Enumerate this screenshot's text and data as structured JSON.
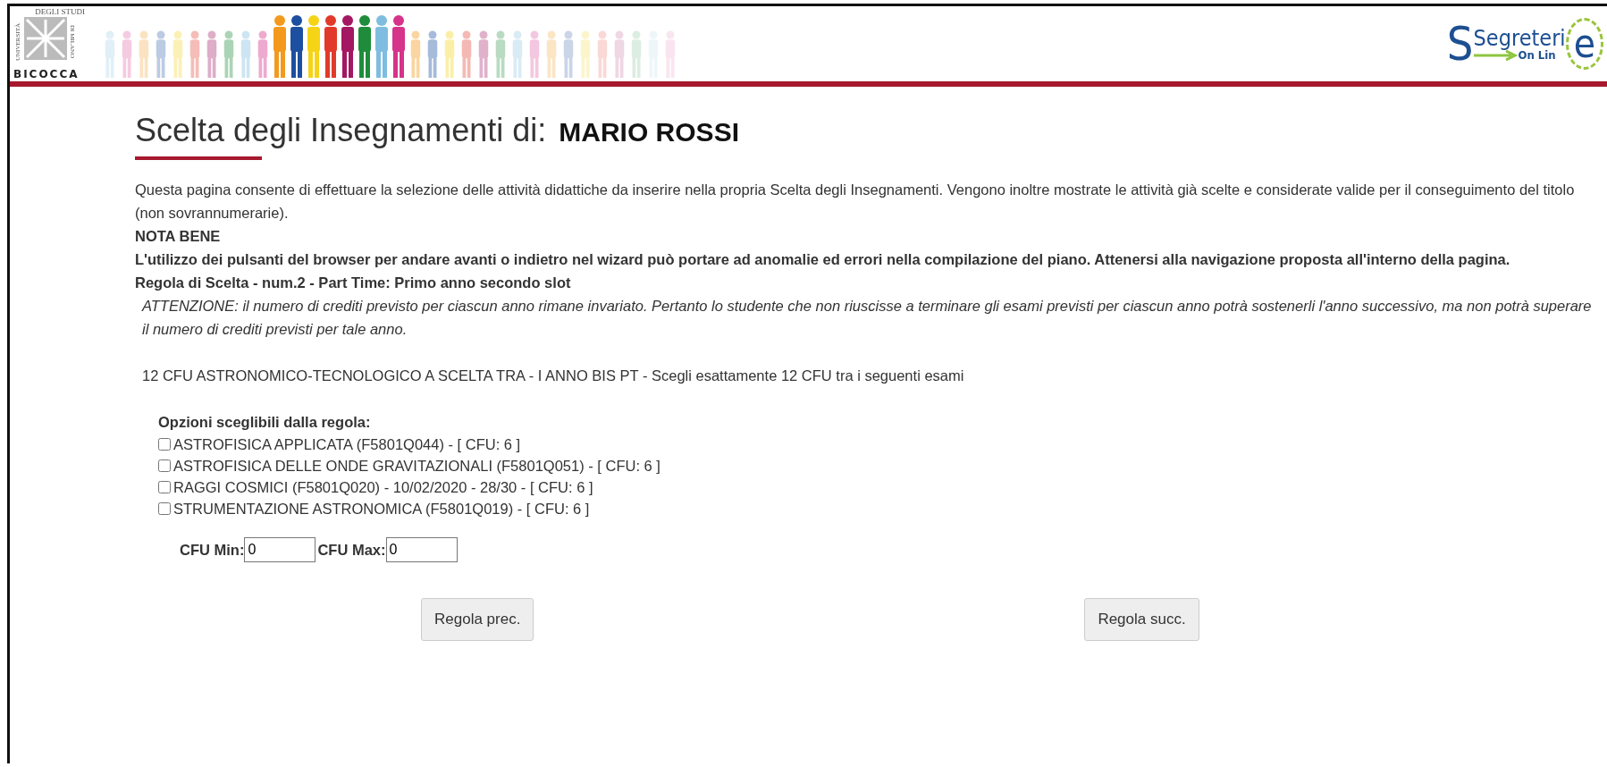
{
  "header": {
    "university_logo": {
      "top": "DEGLI STUDI",
      "left": "UNIVERSITÀ",
      "right": "DI MILANO",
      "bottom": "BICOCCA"
    },
    "brand_logo": {
      "title": "Segreteri",
      "big_letter_left": "S",
      "big_letter_right": "e",
      "subtitle": "On Lin"
    }
  },
  "page_title": "Scelta degli Insegnamenti di:",
  "student_name": "MARIO ROSSI",
  "intro": "Questa pagina consente di effettuare la selezione delle attività didattiche da inserire nella propria Scelta degli Insegnamenti. Vengono inoltre mostrate le attività già scelte e considerate valide per il conseguimento del titolo (non sovrannumerarie).",
  "note_heading": "NOTA BENE",
  "note": "L'utilizzo dei pulsanti del browser per andare avanti o indietro nel wizard può portare ad anomalie ed errori nella compilazione del piano. Attenersi alla navigazione proposta all'interno della pagina.",
  "rule_title": "Regola di Scelta - num.2 - Part Time: Primo anno secondo slot",
  "warning": "ATTENZIONE: il numero di crediti previsto per ciascun anno rimane invariato. Pertanto lo studente che non riuscisse a terminare gli esami previsti per ciascun anno potrà sostenerli l'anno successivo, ma non potrà superare il numero di crediti previsti per tale anno.",
  "rule_description": "12 CFU ASTRONOMICO-TECNOLOGICO A SCELTA TRA - I ANNO BIS PT - Scegli esattamente 12 CFU tra i seguenti esami",
  "options_heading": "Opzioni sceglibili dalla regola:",
  "options": [
    {
      "label": "ASTROFISICA APPLICATA (F5801Q044) - [ CFU: 6 ]",
      "checked": false
    },
    {
      "label": "ASTROFISICA DELLE ONDE GRAVITAZIONALI (F5801Q051) - [ CFU: 6 ]",
      "checked": false
    },
    {
      "label": "RAGGI COSMICI (F5801Q020) - 10/02/2020 - 28/30 - [ CFU: 6 ]",
      "checked": false
    },
    {
      "label": "STRUMENTAZIONE ASTRONOMICA (F5801Q019) - [ CFU: 6 ]",
      "checked": false
    }
  ],
  "cfu_fields": [
    {
      "label": "CFU Min:",
      "value": "0"
    },
    {
      "label": "CFU Max:",
      "value": "0"
    }
  ],
  "buttons": [
    "Regola prec.",
    "Regola succ."
  ]
}
